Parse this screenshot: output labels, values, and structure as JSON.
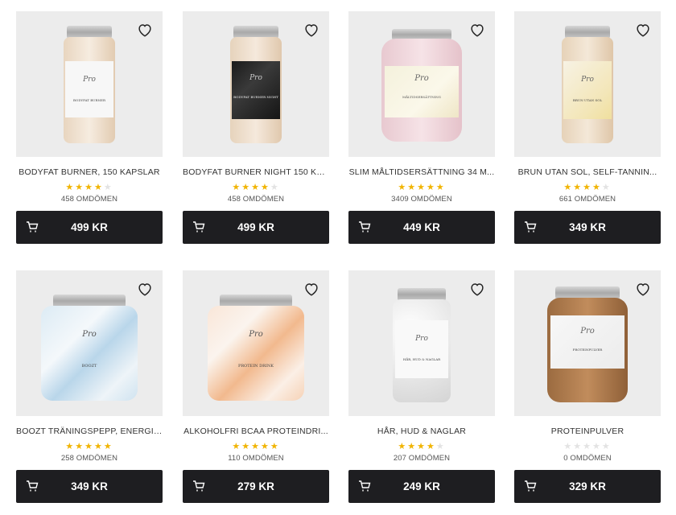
{
  "colors": {
    "star_on": "#f1b400",
    "star_off": "#e3e3e3",
    "button_bg": "#1e1e21",
    "image_bg": "#ececec"
  },
  "icons": {
    "wishlist": "heart-outline-icon",
    "cart": "cart-icon"
  },
  "products": [
    {
      "title": "BODYFAT BURNER, 150 KAPSLAR",
      "rating": 4,
      "reviews": "458 OMDÖMEN",
      "price": "499 KR",
      "label": "BODYFAT BURNER"
    },
    {
      "title": "BODYFAT BURNER NIGHT 150 KA...",
      "rating": 4,
      "reviews": "458 OMDÖMEN",
      "price": "499 KR",
      "label": "BODYFAT BURNER NIGHT"
    },
    {
      "title": "SLIM MÅLTIDSERSÄTTNING 34 M...",
      "rating": 5,
      "reviews": "3409 OMDÖMEN",
      "price": "449 KR",
      "label": "MÅLTIDSERSÄTTNING"
    },
    {
      "title": "BRUN UTAN SOL, SELF-TANNIN...",
      "rating": 4,
      "reviews": "661 OMDÖMEN",
      "price": "349 KR",
      "label": "BRUN UTAN SOL"
    },
    {
      "title": "BOOZT TRÄNINGSPEPP, ENERGI I...",
      "rating": 5,
      "reviews": "258 OMDÖMEN",
      "price": "349 KR",
      "label": "BOOZT"
    },
    {
      "title": "ALKOHOLFRI BCAA PROTEINDRI...",
      "rating": 5,
      "reviews": "110 OMDÖMEN",
      "price": "279 KR",
      "label": "PROTEIN DRINK"
    },
    {
      "title": "HÅR, HUD & NAGLAR",
      "rating": 4,
      "reviews": "207 OMDÖMEN",
      "price": "249 KR",
      "label": "HÅR, HUD & NAGLAR"
    },
    {
      "title": "PROTEINPULVER",
      "rating": 0,
      "reviews": "0 OMDÖMEN",
      "price": "329 KR",
      "label": "PROTEINPULVER"
    }
  ]
}
